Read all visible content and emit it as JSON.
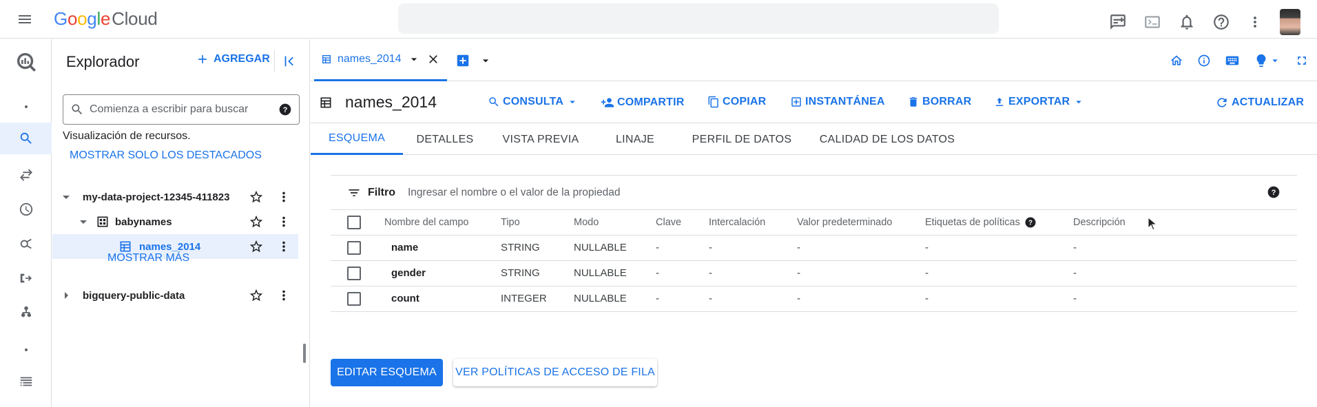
{
  "topbar": {
    "logo_google": "Google",
    "logo_cloud": "Cloud",
    "avatar_alt": "user avatar"
  },
  "rail": {
    "icons": [
      "bigquery-logo-icon",
      "dot-icon",
      "search-icon",
      "transfers-icon",
      "history-icon",
      "analytics-icon",
      "pipelines-icon",
      "connections-icon",
      "dot-icon",
      "list-icon"
    ]
  },
  "explorer": {
    "title": "Explorador",
    "add_label": "AGREGAR",
    "search_placeholder": "Comienza a escribir para buscar",
    "resources_label": "Visualización de recursos.",
    "starred_only_label": "MOSTRAR SOLO LOS DESTACADOS",
    "tree": [
      {
        "label": "my-data-project-12345-411823",
        "level": 0,
        "expanded": true,
        "type": "project"
      },
      {
        "label": "babynames",
        "level": 1,
        "expanded": true,
        "type": "dataset"
      },
      {
        "label": "names_2014",
        "level": 2,
        "type": "table",
        "selected": true
      },
      {
        "label": "bigquery-public-data",
        "level": 0,
        "expanded": false,
        "type": "project"
      }
    ],
    "show_more_label": "MOSTRAR MÁS"
  },
  "main": {
    "tab": {
      "label": "names_2014"
    },
    "table_title": "names_2014",
    "actions": {
      "query": "CONSULTA",
      "share": "COMPARTIR",
      "copy": "COPIAR",
      "snapshot": "INSTANTÁNEA",
      "delete": "BORRAR",
      "export": "EXPORTAR",
      "refresh": "ACTUALIZAR"
    },
    "subtabs": [
      "ESQUEMA",
      "DETALLES",
      "VISTA PREVIA",
      "LINAJE",
      "PERFIL DE DATOS",
      "CALIDAD DE LOS DATOS"
    ],
    "active_subtab": "ESQUEMA",
    "filter": {
      "label": "Filtro",
      "placeholder": "Ingresar el nombre o el valor de la propiedad"
    },
    "schema": {
      "columns": [
        "Nombre del campo",
        "Tipo",
        "Modo",
        "Clave",
        "Intercalación",
        "Valor predeterminado",
        "Etiquetas de políticas",
        "Descripción"
      ],
      "rows": [
        {
          "name": "name",
          "type": "STRING",
          "mode": "NULLABLE",
          "key": "-",
          "collation": "-",
          "default": "-",
          "policy": "-",
          "description": "-"
        },
        {
          "name": "gender",
          "type": "STRING",
          "mode": "NULLABLE",
          "key": "-",
          "collation": "-",
          "default": "-",
          "policy": "-",
          "description": "-"
        },
        {
          "name": "count",
          "type": "INTEGER",
          "mode": "NULLABLE",
          "key": "-",
          "collation": "-",
          "default": "-",
          "policy": "-",
          "description": "-"
        }
      ]
    },
    "edit_schema_label": "EDITAR ESQUEMA",
    "row_access_label": "VER POLÍTICAS DE ACCESO DE FILA"
  },
  "colors": {
    "accent": "#1a73e8",
    "text": "#202124",
    "muted": "#5f6368",
    "border": "#dadce0",
    "selected_bg": "#e8f0fe"
  }
}
